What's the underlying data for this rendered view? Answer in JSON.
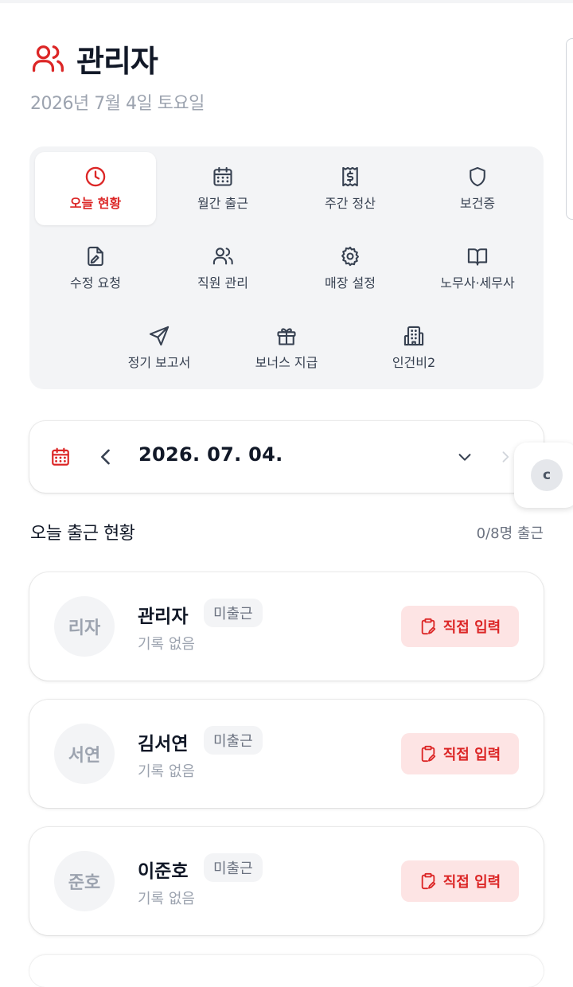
{
  "header": {
    "title": "관리자",
    "date": "2026년 7월 4일 토요일"
  },
  "menu": {
    "items": [
      {
        "label": "오늘 현황",
        "icon": "clock-icon",
        "active": true
      },
      {
        "label": "월간 출근",
        "icon": "calendar-icon"
      },
      {
        "label": "주간 정산",
        "icon": "receipt-icon"
      },
      {
        "label": "보건증",
        "icon": "shield-icon"
      },
      {
        "label": "수정 요청",
        "icon": "file-edit-icon"
      },
      {
        "label": "직원 관리",
        "icon": "users-icon"
      },
      {
        "label": "매장 설정",
        "icon": "gear-icon"
      },
      {
        "label": "노무사·세무사",
        "icon": "book-icon"
      },
      {
        "label": "정기 보고서",
        "icon": "send-icon"
      },
      {
        "label": "보너스 지급",
        "icon": "gift-icon"
      },
      {
        "label": "인건비2",
        "icon": "building-icon"
      }
    ]
  },
  "date_picker": {
    "value": "2026. 07. 04."
  },
  "floating": {
    "label": "c"
  },
  "section": {
    "title": "오늘 출근 현황",
    "count": "0/8명 출근"
  },
  "employees": [
    {
      "initials": "리자",
      "name": "관리자",
      "status": "미출근",
      "record": "기록 없음",
      "action": "직접 입력"
    },
    {
      "initials": "서연",
      "name": "김서연",
      "status": "미출근",
      "record": "기록 없음",
      "action": "직접 입력"
    },
    {
      "initials": "준호",
      "name": "이준호",
      "status": "미출근",
      "record": "기록 없음",
      "action": "직접 입력"
    }
  ],
  "colors": {
    "accent": "#dc2626",
    "accent_bg": "#fde4e4",
    "panel_bg": "#f3f4f6",
    "muted": "#9ca3af"
  }
}
